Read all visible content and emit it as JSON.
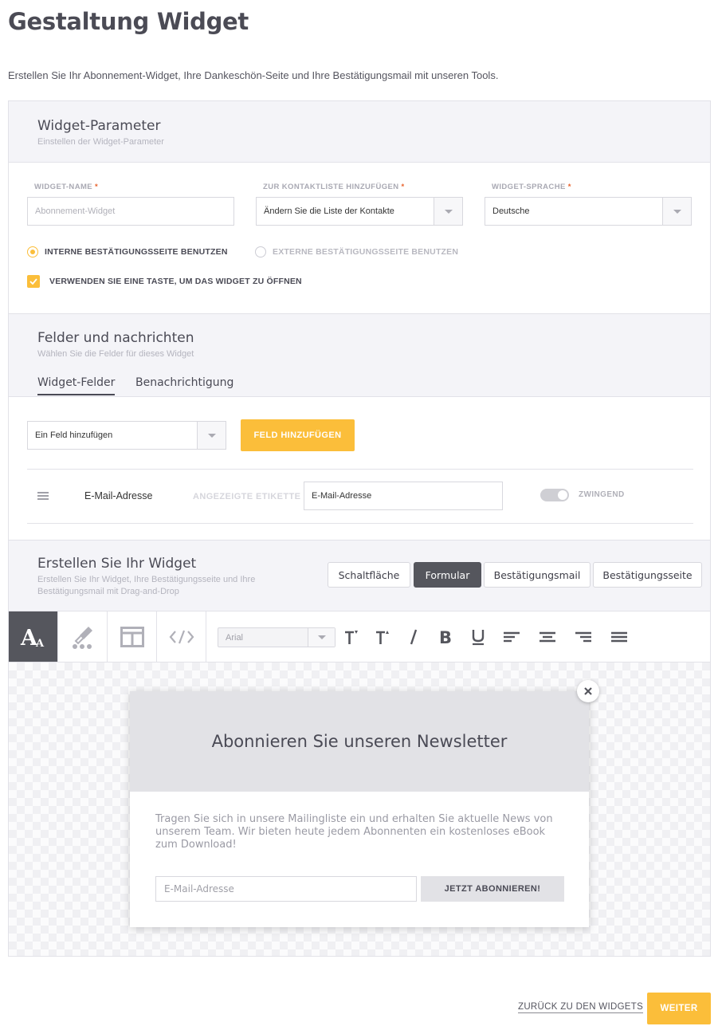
{
  "page": {
    "title": "Gestaltung Widget",
    "subtitle": "Erstellen Sie Ihr Abonnement-Widget, Ihre Dankeschön-Seite und Ihre Bestätigungsmail mit unseren Tools."
  },
  "params": {
    "title": "Widget-Parameter",
    "subtitle": "Einstellen der Widget-Parameter",
    "widget_name": {
      "label": "Widget-Name",
      "required": "*",
      "placeholder": "Abonnement-Widget"
    },
    "contact_list": {
      "label": "Zur Kontaktliste hinzufügen",
      "required": "*",
      "value": "Ändern Sie die Liste der Kontakte"
    },
    "language": {
      "label": "Widget-Sprache",
      "required": "*",
      "value": "Deutsche"
    },
    "radio_internal": "Interne Bestätigungsseite benutzen",
    "radio_external": "Externe Bestätigungsseite benutzen",
    "checkbox_button": "Verwenden Sie eine Taste, um das Widget zu öffnen"
  },
  "fields": {
    "title": "Felder und nachrichten",
    "subtitle": "Wählen Sie die Felder für dieses Widget",
    "tabs": [
      {
        "label": "Widget-Felder",
        "active": true
      },
      {
        "label": "Benachrichtigung",
        "active": false
      }
    ],
    "add_select": "Ein Feld hinzufügen",
    "add_button": "Feld hinzufügen",
    "row": {
      "name": "E-Mail-Adresse",
      "label_caption": "Angezeigte Etikette",
      "label_value": "E-Mail-Adresse",
      "toggle_label": "Zwingend"
    }
  },
  "builder": {
    "title": "Erstellen Sie Ihr Widget",
    "subtitle": "Erstellen Sie Ihr Widget, Ihre Bestätigungsseite und Ihre Bestätigungsmail mit Drag-and-Drop",
    "views": [
      {
        "label": "Schaltfläche",
        "active": false
      },
      {
        "label": "Formular",
        "active": true
      },
      {
        "label": "Bestätigungsmail",
        "active": false
      },
      {
        "label": "Bestätigungsseite",
        "active": false
      }
    ],
    "font_select": "Arial"
  },
  "preview": {
    "heading": "Abonnieren Sie unseren Newsletter",
    "text": "Tragen Sie sich in unsere Mailingliste ein und erhalten Sie aktuelle News von unserem Team. Wir bieten heute jedem Abonnenten ein kostenloses eBook zum Download!",
    "email_placeholder": "E-Mail-Adresse",
    "subscribe_button": "JETZT ABONNIEREN!"
  },
  "footer": {
    "back": "Zurück zu den Widgets",
    "next": "Weiter"
  },
  "colors": {
    "accent": "#fbbe3a",
    "dark": "#55565d",
    "required": "#e8622c"
  }
}
